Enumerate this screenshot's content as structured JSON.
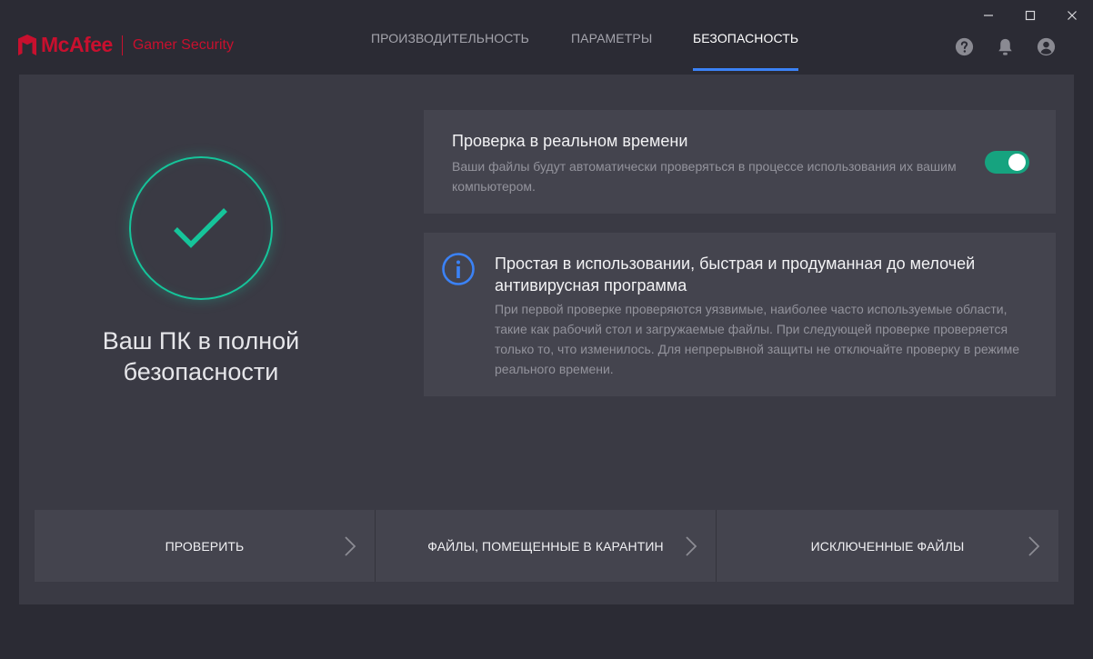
{
  "brand": {
    "name": "McAfee",
    "product": "Gamer Security",
    "color": "#c8102e"
  },
  "window_controls": [
    "minimize-icon",
    "maximize-icon",
    "close-icon"
  ],
  "nav": {
    "tabs": [
      {
        "label": "ПРОИЗВОДИТЕЛЬНОСТЬ",
        "active": false
      },
      {
        "label": "ПАРАМЕТРЫ",
        "active": false
      },
      {
        "label": "БЕЗОПАСНОСТЬ",
        "active": true
      }
    ],
    "accent": "#3b82f6"
  },
  "header_icons": [
    "help-icon",
    "bell-icon",
    "account-icon"
  ],
  "status": {
    "text": "Ваш ПК в полной безопасности",
    "color": "#16c49a"
  },
  "realtime": {
    "title": "Проверка в реальном времени",
    "description": "Ваши файлы будут автоматически проверяться в процессе использования их вашим компьютером.",
    "enabled": true
  },
  "info": {
    "title": "Простая в использовании, быстрая и продуманная до мелочей антивирусная программа",
    "description": "При первой проверке проверяются уязвимые, наиболее часто используемые области, такие как рабочий стол и загружаемые файлы. При следующей проверке проверяется только то, что изменилось. Для непрерывной защиты не отключайте проверку в режиме реального времени."
  },
  "actions": [
    {
      "label": "ПРОВЕРИТЬ"
    },
    {
      "label": "ФАЙЛЫ, ПОМЕЩЕННЫЕ В КАРАНТИН"
    },
    {
      "label": "ИСКЛЮЧЕННЫЕ ФАЙЛЫ"
    }
  ]
}
